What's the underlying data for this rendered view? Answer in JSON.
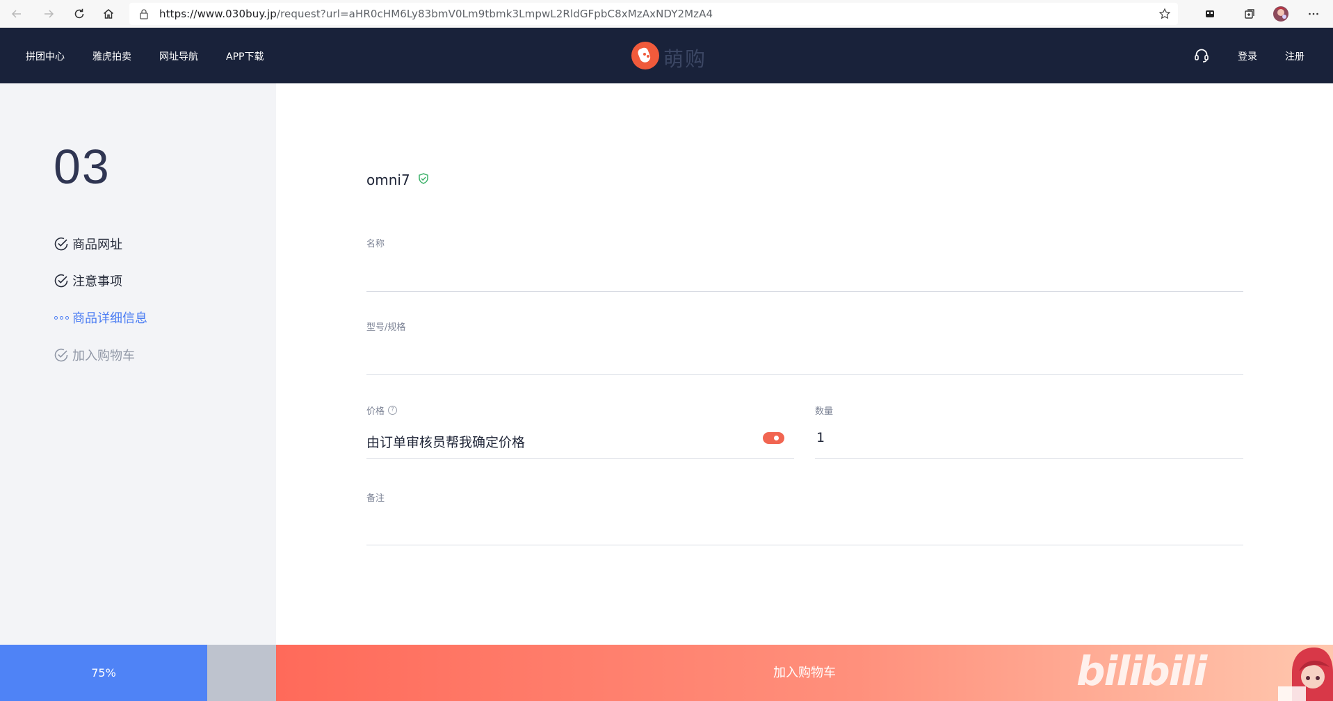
{
  "browser": {
    "url_host": "https://www.030buy.jp",
    "url_rest": "/request?url=aHR0cHM6Ly83bmV0Lm9tbmk3LmpwL2RldGFpbC8xMzAxNDY2MzA4"
  },
  "header": {
    "nav": [
      "拼团中心",
      "雅虎拍卖",
      "网址导航",
      "APP下载"
    ],
    "logo_text": "萌购",
    "login": "登录",
    "register": "注册",
    "colors": {
      "bar": "#19223a",
      "logo": "#f05a3b"
    }
  },
  "sidebar": {
    "step_number": "03",
    "steps": [
      {
        "label": "商品网址",
        "state": "done"
      },
      {
        "label": "注意事项",
        "state": "done"
      },
      {
        "label": "商品详细信息",
        "state": "active"
      },
      {
        "label": "加入购物车",
        "state": "todo"
      }
    ]
  },
  "form": {
    "shop_name": "omni7",
    "name_label": "名称",
    "name_value": "",
    "model_label": "型号/规格",
    "model_value": "",
    "price_label": "价格",
    "price_value": "由订单审核员帮我确定价格",
    "quantity_label": "数量",
    "quantity_value": "1",
    "note_label": "备注",
    "note_value": ""
  },
  "bottom": {
    "progress": 0.75,
    "progress_text": "75%",
    "cart_button": "加入购物车",
    "watermark": "bilibili"
  },
  "icons": [
    "back-icon",
    "forward-icon",
    "refresh-icon",
    "home-icon",
    "lock-icon",
    "star-icon",
    "collections-icon",
    "extensions-icon",
    "profile-avatar",
    "more-icon",
    "headset-icon",
    "check-circle-icon",
    "dots-icon",
    "shield-check-icon",
    "help-icon"
  ]
}
